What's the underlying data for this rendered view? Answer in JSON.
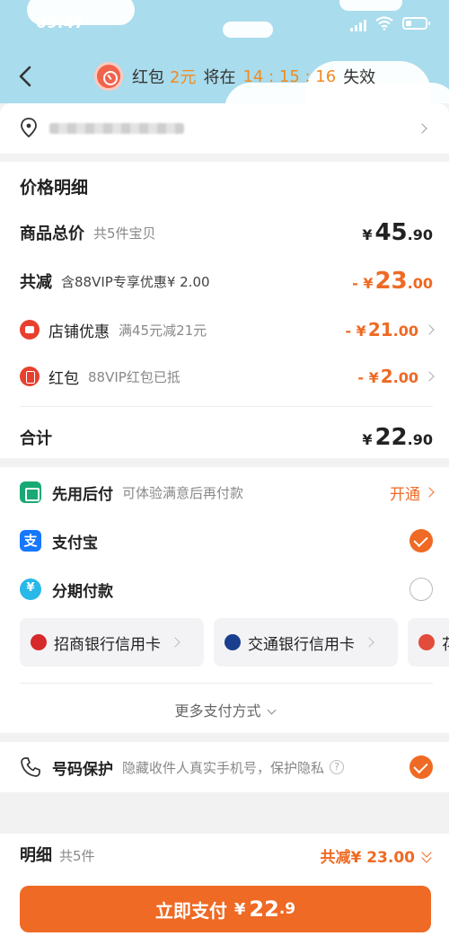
{
  "status": {
    "time": "09:47"
  },
  "header": {
    "banner_prefix": "红包",
    "amount": "2元",
    "middle": "将在",
    "countdown": "14 : 15 : 16",
    "suffix": "失效"
  },
  "price": {
    "title": "价格明细",
    "goods_label": "商品总价",
    "goods_sub": "共5件宝贝",
    "goods_yen": "¥",
    "goods_int": "45",
    "goods_dec": ".90",
    "reduce_label": "共减",
    "reduce_sub": "含88VIP专享优惠¥ 2.00",
    "reduce_prefix": "- ¥",
    "reduce_int": "23",
    "reduce_dec": ".00",
    "shop_label": "店铺优惠",
    "shop_sub": "满45元减21元",
    "shop_prefix": "- ¥",
    "shop_int": "21",
    "shop_dec": ".00",
    "redpack_label": "红包",
    "redpack_sub": "88VIP红包已抵",
    "redpack_prefix": "- ¥",
    "redpack_int": "2",
    "redpack_dec": ".00",
    "total_label": "合计",
    "total_yen": "¥",
    "total_int": "22",
    "total_dec": ".90"
  },
  "payment": {
    "later_label": "先用后付",
    "later_sub": "可体验满意后再付款",
    "later_action": "开通",
    "alipay_label": "支付宝",
    "alipay_icon": "支",
    "installment_label": "分期付款",
    "banks": [
      "招商银行信用卡",
      "交通银行信用卡",
      "花"
    ],
    "more": "更多支付方式"
  },
  "phone": {
    "label": "号码保护",
    "sub": "隐藏收件人真实手机号，保护隐私",
    "help": "?"
  },
  "bottom": {
    "detail_label": "明细",
    "detail_sub": "共5件",
    "saved": "共减¥ 23.00",
    "pay_label": "立即支付",
    "pay_yen": "¥",
    "pay_int": "22",
    "pay_dec": ".9"
  },
  "colors": {
    "accent": "#ef6a24",
    "sky": "#a9dcec",
    "alipay": "#1677ff"
  }
}
